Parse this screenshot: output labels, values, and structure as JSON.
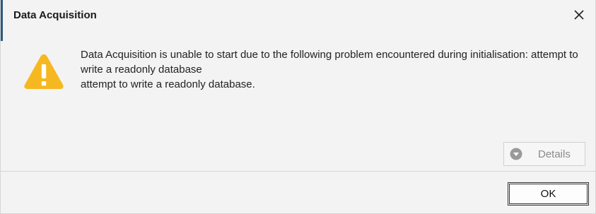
{
  "dialog": {
    "title": "Data Acquisition",
    "message": {
      "line1": "Data Acquisition is unable to start due to the following problem encountered during initialisation: attempt to",
      "line2": "write a readonly database",
      "line3": "attempt to write a readonly database."
    },
    "details_label": "Details",
    "ok_label": "OK",
    "icon": "warning-triangle",
    "colors": {
      "warning": "#f6b821",
      "background": "#f3f3f3"
    }
  }
}
